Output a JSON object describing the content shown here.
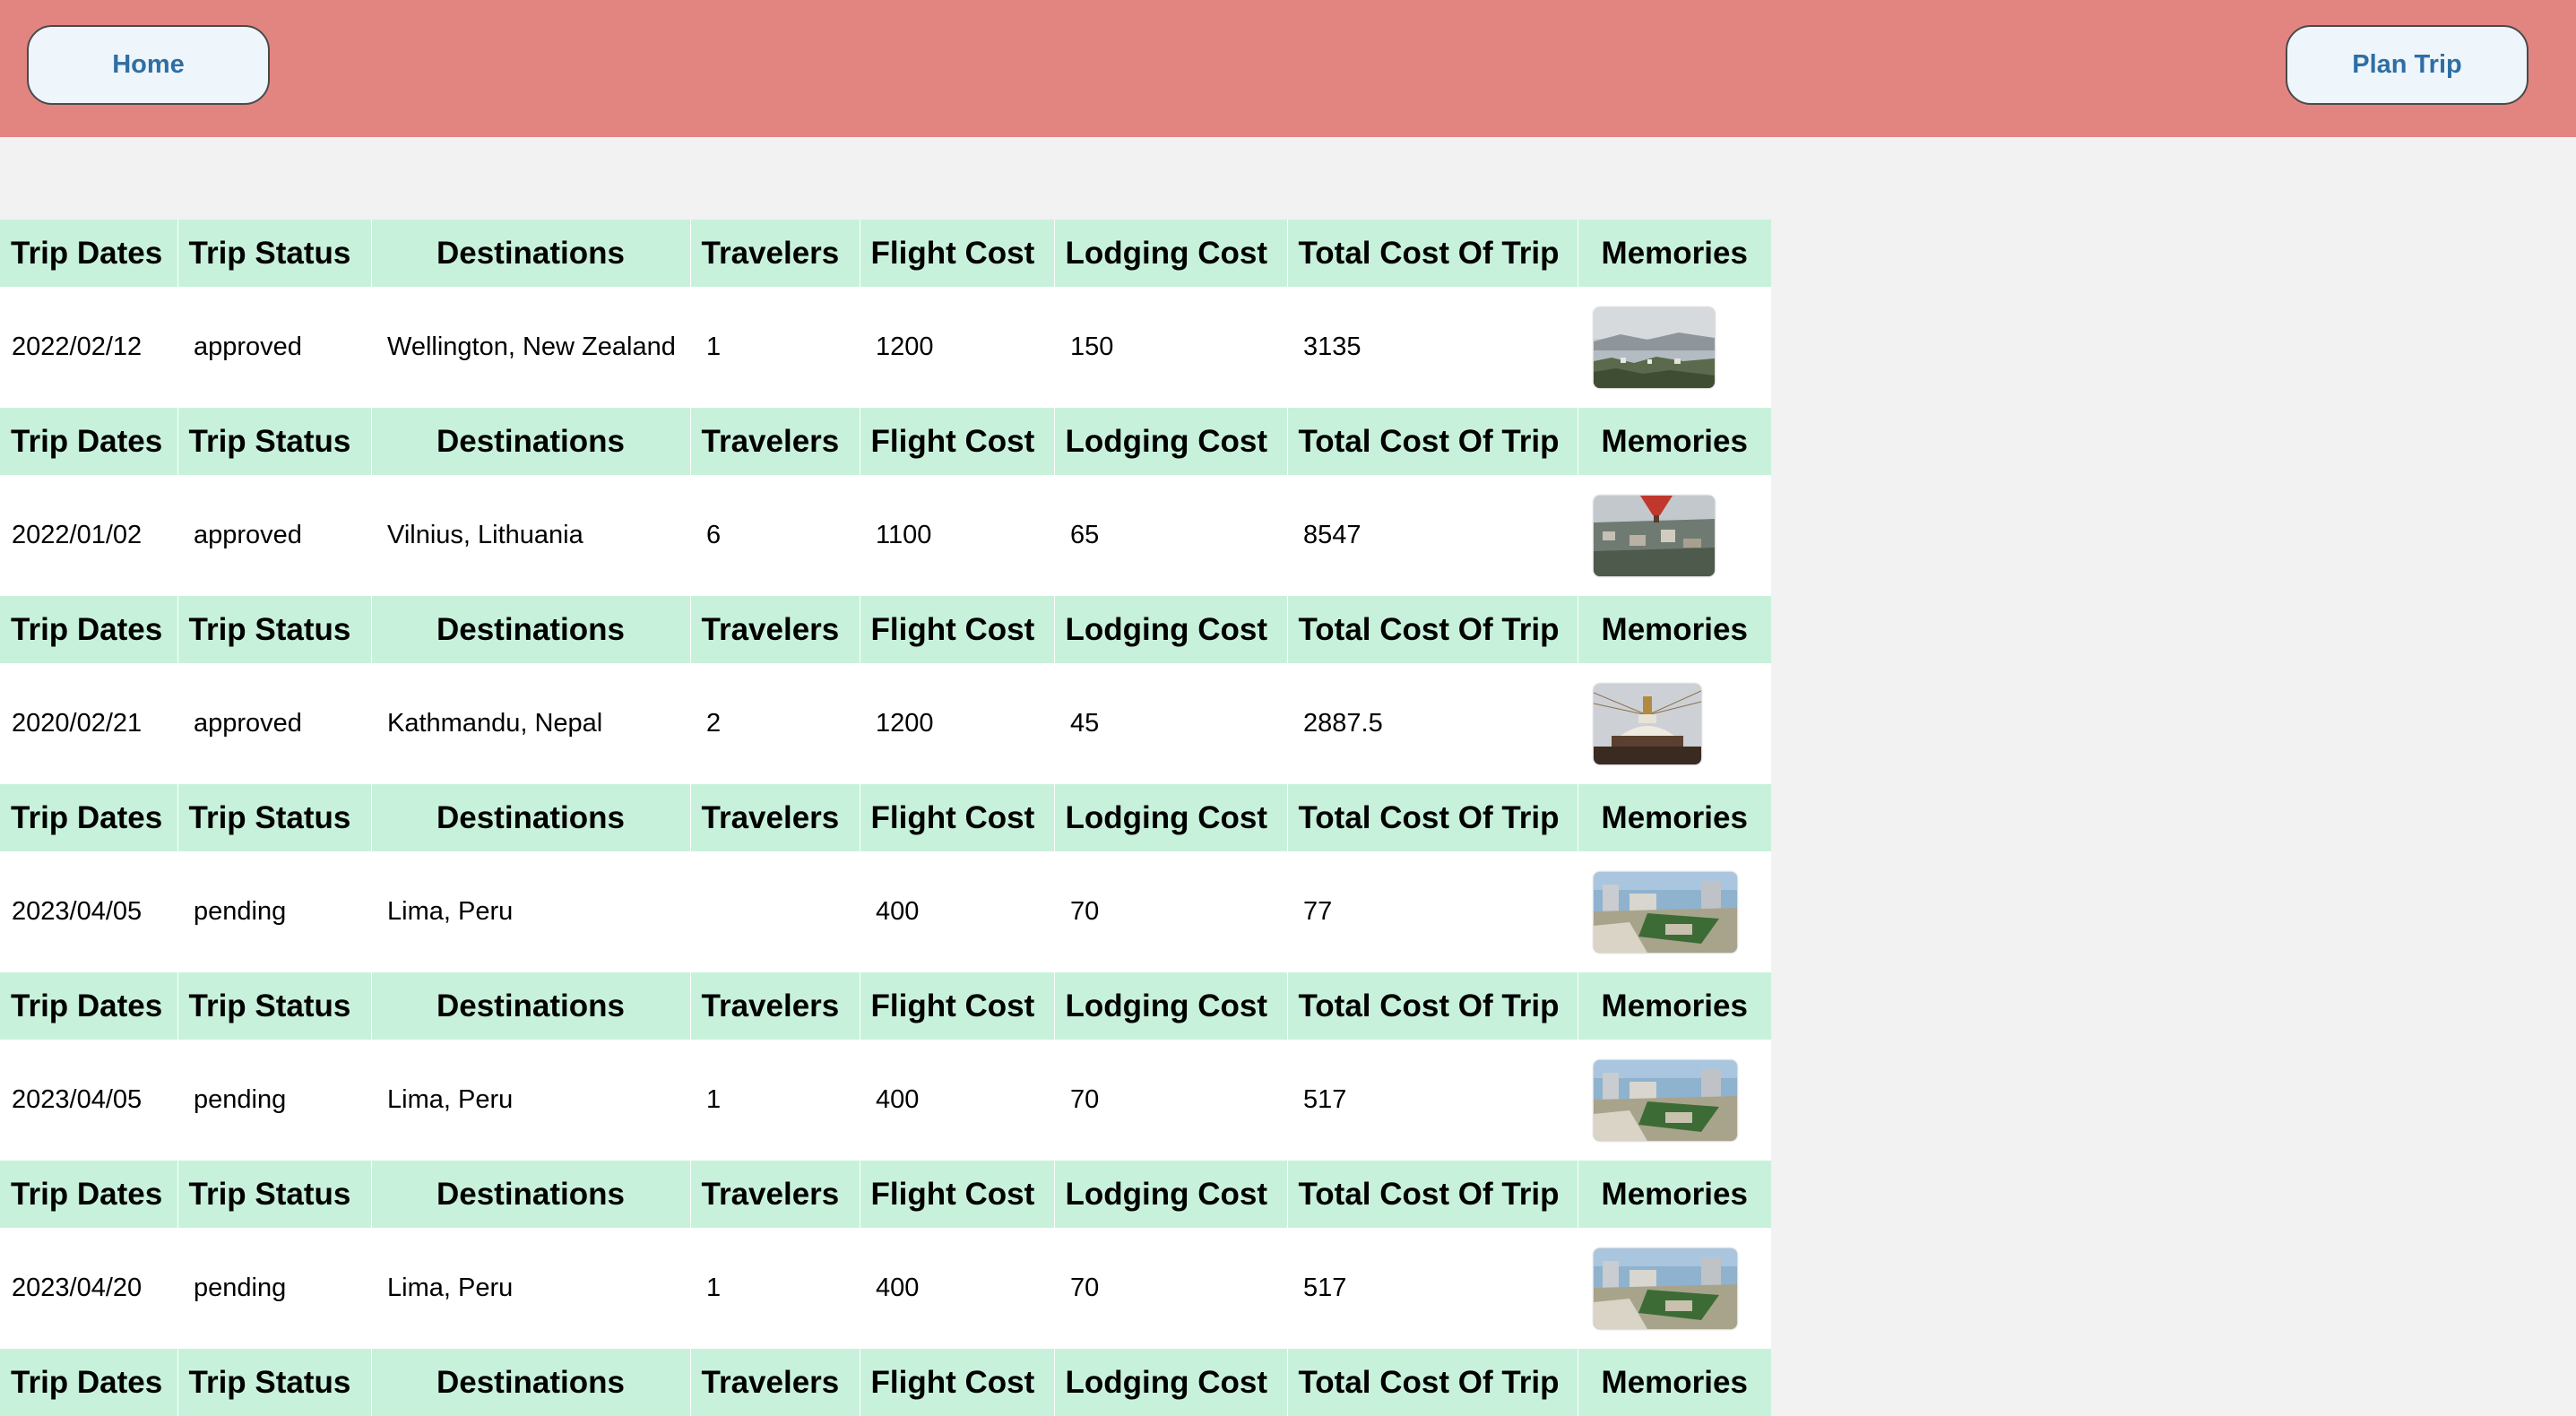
{
  "nav": {
    "home_label": "Home",
    "plan_trip_label": "Plan Trip"
  },
  "columns": [
    "Trip Dates",
    "Trip Status",
    "Destinations",
    "Travelers",
    "Flight Cost",
    "Lodging Cost",
    "Total Cost Of Trip",
    "Memories"
  ],
  "trips": [
    {
      "date": "2022/02/12",
      "status": "approved",
      "destination": "Wellington, New Zealand",
      "travelers": "1",
      "flight_cost": "1200",
      "lodging_cost": "150",
      "total_cost": "3135",
      "memory_image": "wellington-city-photo"
    },
    {
      "date": "2022/01/02",
      "status": "approved",
      "destination": "Vilnius, Lithuania",
      "travelers": "6",
      "flight_cost": "1100",
      "lodging_cost": "65",
      "total_cost": "8547",
      "memory_image": "vilnius-balloon-photo"
    },
    {
      "date": "2020/02/21",
      "status": "approved",
      "destination": "Kathmandu, Nepal",
      "travelers": "2",
      "flight_cost": "1200",
      "lodging_cost": "45",
      "total_cost": "2887.5",
      "memory_image": "kathmandu-stupa-photo"
    },
    {
      "date": "2023/04/05",
      "status": "pending",
      "destination": "Lima, Peru",
      "travelers": "",
      "flight_cost": "400",
      "lodging_cost": "70",
      "total_cost": "77",
      "memory_image": "lima-city-photo"
    },
    {
      "date": "2023/04/05",
      "status": "pending",
      "destination": "Lima, Peru",
      "travelers": "1",
      "flight_cost": "400",
      "lodging_cost": "70",
      "total_cost": "517",
      "memory_image": "lima-city-photo"
    },
    {
      "date": "2023/04/20",
      "status": "pending",
      "destination": "Lima, Peru",
      "travelers": "1",
      "flight_cost": "400",
      "lodging_cost": "70",
      "total_cost": "517",
      "memory_image": "lima-city-photo"
    }
  ],
  "colors": {
    "header_bg": "#e28581",
    "page_bg": "#f2f2f2",
    "table_header_bg": "#c8f1db",
    "button_bg": "#eef6fb",
    "button_text": "#2f6ea5"
  }
}
